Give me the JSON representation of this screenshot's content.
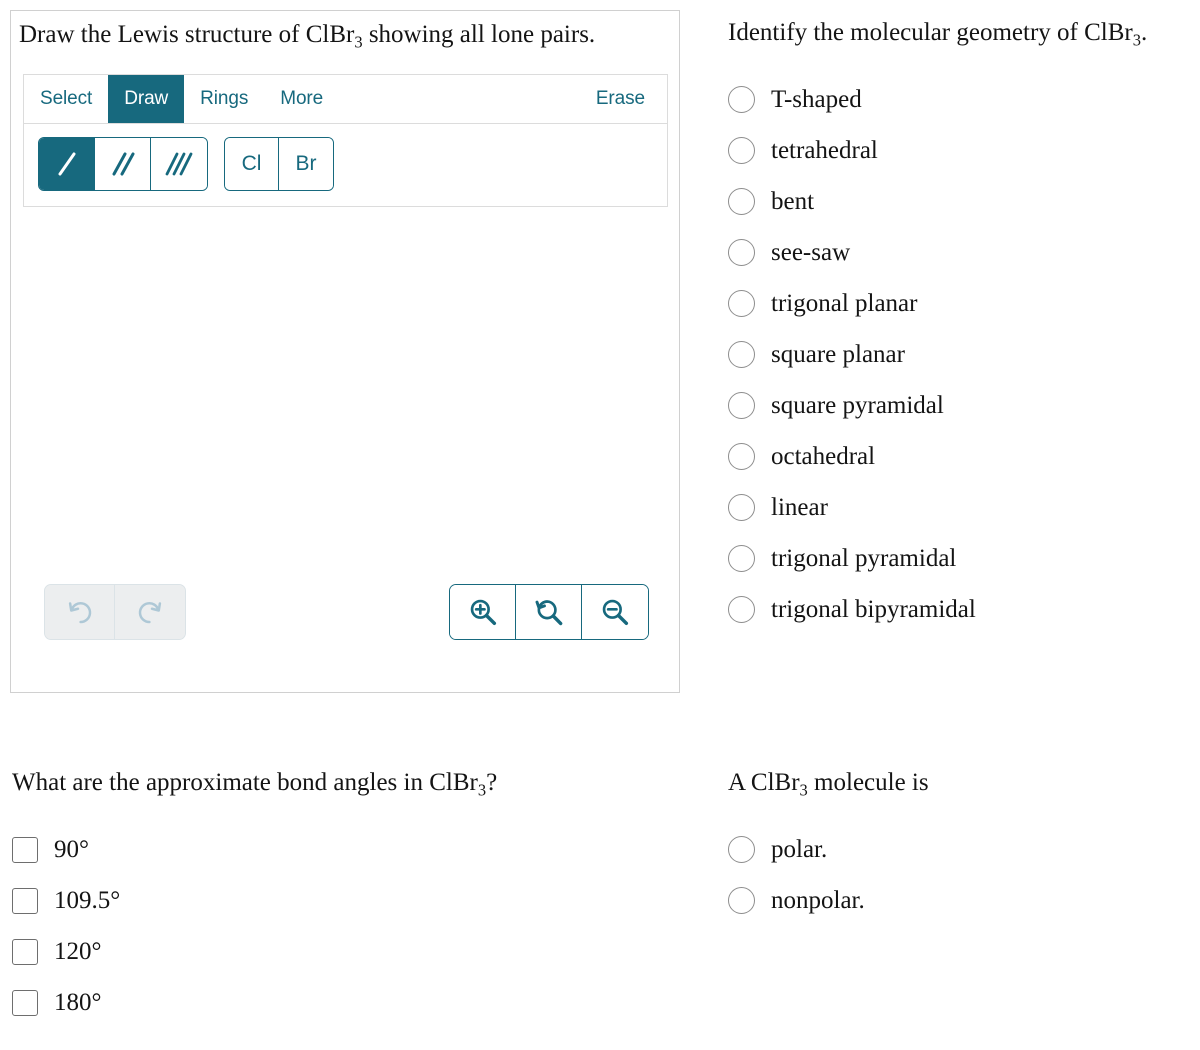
{
  "editor": {
    "prompt_prefix": "Draw the Lewis structure of ClBr",
    "prompt_sub": "3",
    "prompt_suffix": " showing all lone pairs.",
    "accent_color": "#17697e",
    "tabs": [
      {
        "label": "Select",
        "active": false,
        "name": "tab-select"
      },
      {
        "label": "Draw",
        "active": true,
        "name": "tab-draw"
      },
      {
        "label": "Rings",
        "active": false,
        "name": "tab-rings"
      },
      {
        "label": "More",
        "active": false,
        "name": "tab-more"
      }
    ],
    "erase_label": "Erase",
    "bond_tools": [
      {
        "icon": "single-bond-icon",
        "selected": true
      },
      {
        "icon": "double-bond-icon",
        "selected": false
      },
      {
        "icon": "triple-bond-icon",
        "selected": false
      }
    ],
    "element_buttons": [
      {
        "label": "Cl"
      },
      {
        "label": "Br"
      }
    ],
    "history_buttons": [
      {
        "icon": "undo-icon",
        "enabled": false
      },
      {
        "icon": "redo-icon",
        "enabled": false
      }
    ],
    "zoom_buttons": [
      {
        "icon": "zoom-in-icon"
      },
      {
        "icon": "zoom-reset-icon"
      },
      {
        "icon": "zoom-out-icon"
      }
    ]
  },
  "question_geometry": {
    "title_prefix": "Identify the molecular geometry of ClBr",
    "title_sub": "3",
    "title_suffix": ".",
    "input_type": "radio",
    "options": [
      {
        "label": "T-shaped",
        "selected": false
      },
      {
        "label": "tetrahedral",
        "selected": false
      },
      {
        "label": "bent",
        "selected": false
      },
      {
        "label": "see-saw",
        "selected": false
      },
      {
        "label": "trigonal planar",
        "selected": false
      },
      {
        "label": "square planar",
        "selected": false
      },
      {
        "label": "square pyramidal",
        "selected": false
      },
      {
        "label": "octahedral",
        "selected": false
      },
      {
        "label": "linear",
        "selected": false
      },
      {
        "label": "trigonal pyramidal",
        "selected": false
      },
      {
        "label": "trigonal bipyramidal",
        "selected": false
      }
    ]
  },
  "question_angles": {
    "title_prefix": "What are the approximate bond angles in ClBr",
    "title_sub": "3",
    "title_suffix": "?",
    "input_type": "checkbox",
    "options": [
      {
        "label": "90°",
        "checked": false
      },
      {
        "label": "109.5°",
        "checked": false
      },
      {
        "label": "120°",
        "checked": false
      },
      {
        "label": "180°",
        "checked": false
      }
    ]
  },
  "question_polarity": {
    "title_prefix": "A ClBr",
    "title_sub": "3",
    "title_suffix": " molecule is",
    "input_type": "radio",
    "options": [
      {
        "label": "polar.",
        "selected": false
      },
      {
        "label": "nonpolar.",
        "selected": false
      }
    ]
  }
}
